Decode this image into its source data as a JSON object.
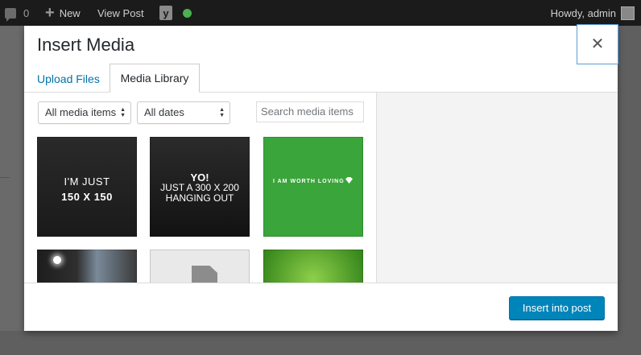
{
  "admin_bar": {
    "comments_count": "0",
    "new_label": "New",
    "view_post_label": "View Post",
    "yoast_letter": "y",
    "howdy_label": "Howdy, admin",
    "status_dot_color": "#4caf50"
  },
  "modal": {
    "title": "Insert Media",
    "close_glyph": "✕",
    "tabs": [
      {
        "label": "Upload Files",
        "active": false
      },
      {
        "label": "Media Library",
        "active": true
      }
    ],
    "filters": {
      "media_type": "All media items",
      "dates": "All dates",
      "search_placeholder": "Search media items"
    },
    "thumbnails": [
      {
        "lines": [
          "I'M JUST",
          "150 X 150"
        ]
      },
      {
        "lines": [
          "YO!",
          "JUST A 300 X 200",
          "HANGING OUT"
        ]
      },
      {
        "lines": [
          "I AM WORTH LOVING"
        ],
        "color": "#3aa53a"
      },
      {
        "lines": []
      },
      {
        "lines": [],
        "icon": "document-icon"
      },
      {
        "lines": [],
        "color": "#3b8a1e"
      }
    ],
    "footer": {
      "insert_label": "Insert into post",
      "insert_color": "#0085ba"
    }
  }
}
